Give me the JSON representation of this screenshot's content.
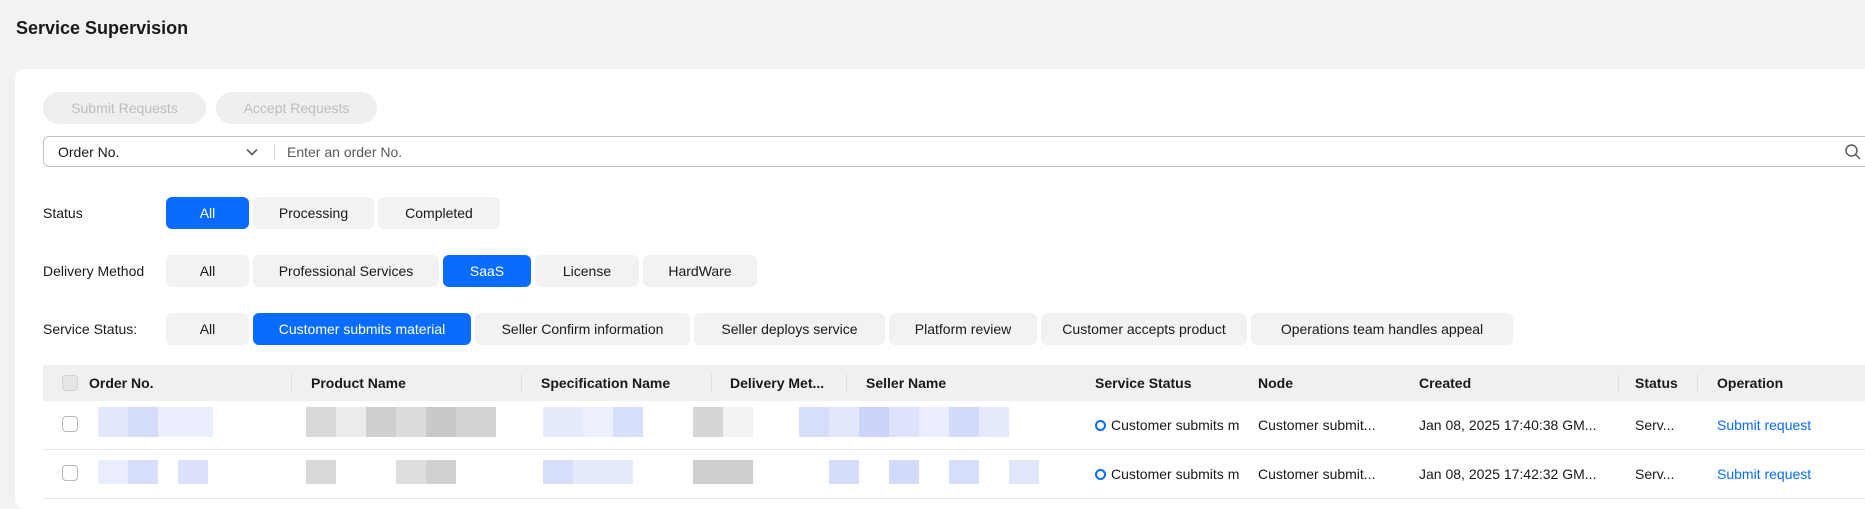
{
  "page": {
    "title": "Service Supervision"
  },
  "toolbar": {
    "submit_label": "Submit Requests",
    "accept_label": "Accept Requests"
  },
  "search": {
    "field": "Order No.",
    "placeholder": "Enter an order No."
  },
  "filters": {
    "status": {
      "label": "Status",
      "options": [
        "All",
        "Processing",
        "Completed"
      ],
      "selected": "All"
    },
    "delivery": {
      "label": "Delivery Method",
      "options": [
        "All",
        "Professional Services",
        "SaaS",
        "License",
        "HardWare"
      ],
      "selected": "SaaS"
    },
    "service_status": {
      "label": "Service Status:",
      "options": [
        "All",
        "Customer submits material",
        "Seller Confirm information",
        "Seller deploys service",
        "Platform review",
        "Customer accepts product",
        "Operations team handles appeal"
      ],
      "selected": "Customer submits material"
    }
  },
  "table": {
    "columns": [
      "Order No.",
      "Product Name",
      "Specification Name",
      "Delivery Met...",
      "Seller Name",
      "Service Status",
      "Node",
      "Created",
      "Status",
      "Operation"
    ],
    "rows": [
      {
        "service_status": "Customer submits m",
        "node": "Customer submit...",
        "created": "Jan 08, 2025 17:40:38 GM...",
        "status": "Serv...",
        "operation": "Submit request"
      },
      {
        "service_status": "Customer submits m",
        "node": "Customer submit...",
        "created": "Jan 08, 2025 17:42:32 GM...",
        "status": "Serv...",
        "operation": "Submit request"
      }
    ]
  },
  "colors": {
    "accent": "#0a6cff",
    "redaction_blue": "#d5dcfa",
    "redaction_gray": "#cfcfcf"
  },
  "icons": [
    "chevron-down-icon",
    "search-icon"
  ]
}
